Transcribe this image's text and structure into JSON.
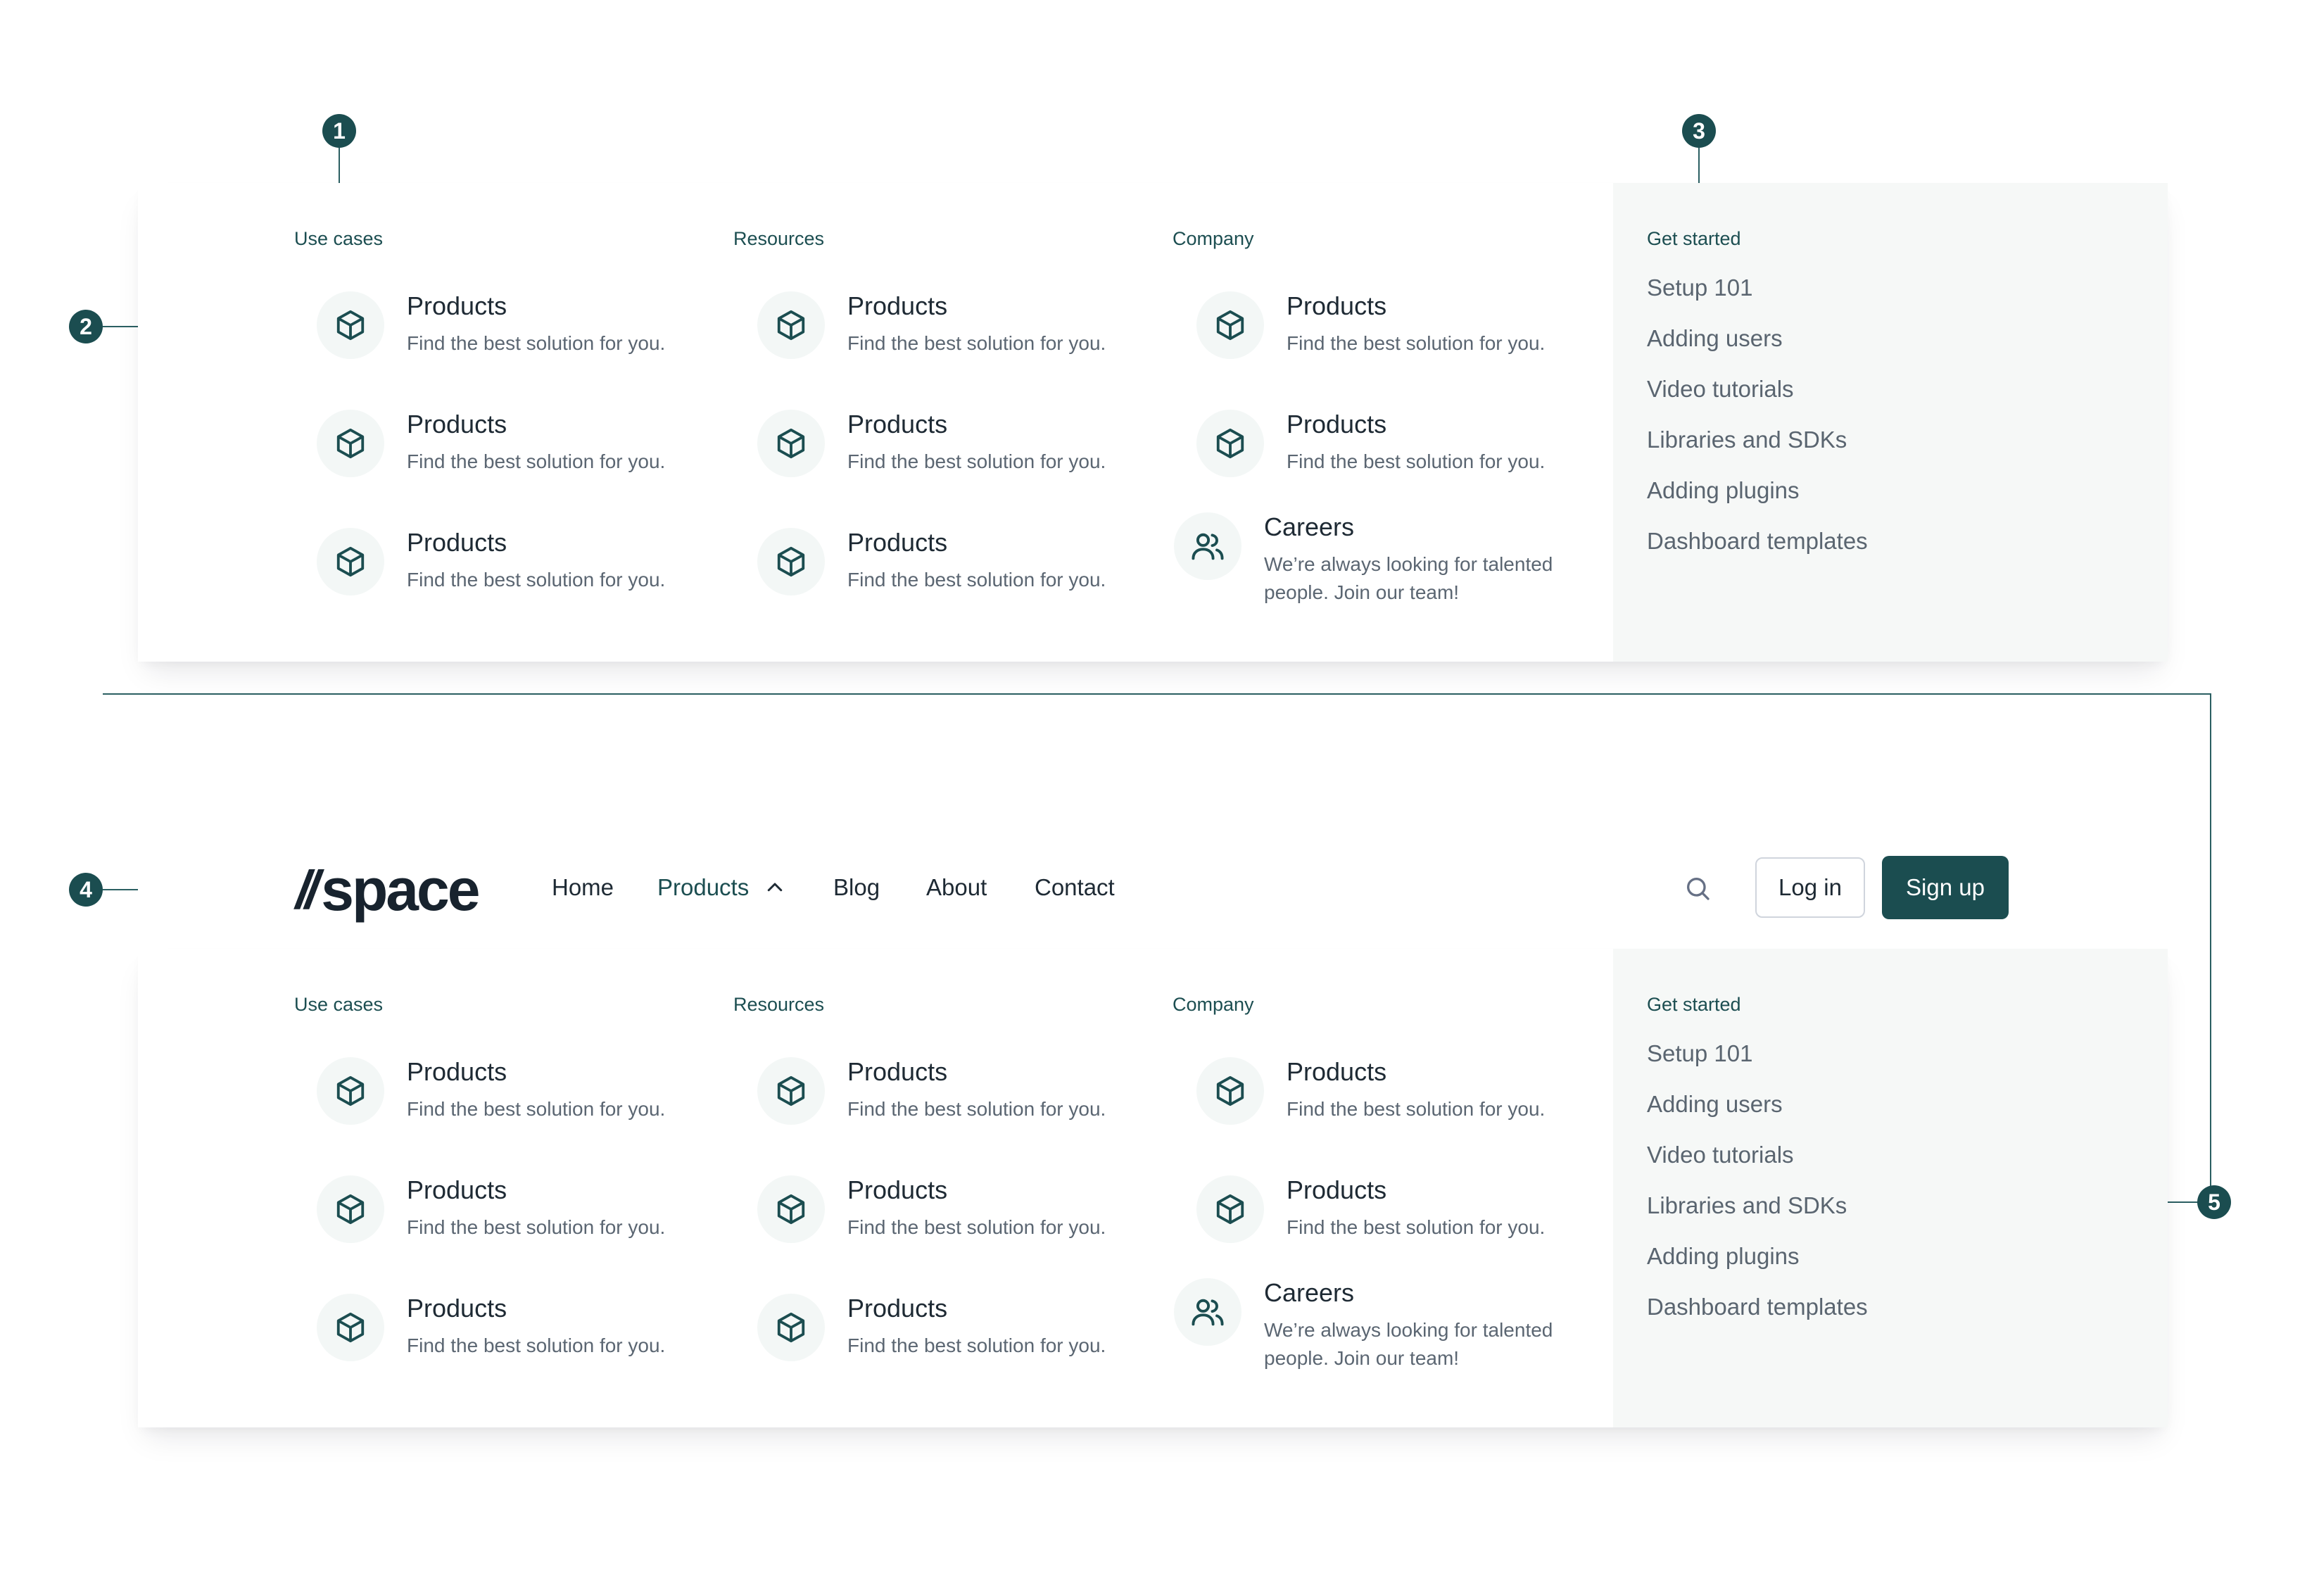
{
  "annotations": {
    "m1": "1",
    "m2": "2",
    "m3": "3",
    "m4": "4",
    "m5": "5"
  },
  "nav": {
    "logo_text": "space",
    "links": [
      "Home",
      "Products",
      "Blog",
      "About",
      "Contact"
    ],
    "active_link": "Products",
    "login_label": "Log in",
    "signup_label": "Sign up",
    "icons": {
      "search": "search-icon",
      "chevron": "chevron-up-icon"
    }
  },
  "menu": {
    "columns": [
      {
        "title": "Use cases",
        "items": [
          {
            "title": "Products",
            "desc": "Find the best solution for you."
          },
          {
            "title": "Products",
            "desc": "Find the best solution for you."
          },
          {
            "title": "Products",
            "desc": "Find the best solution for you."
          }
        ]
      },
      {
        "title": "Resources",
        "items": [
          {
            "title": "Products",
            "desc": "Find the best solution for you."
          },
          {
            "title": "Products",
            "desc": "Find the best solution for you."
          },
          {
            "title": "Products",
            "desc": "Find the best solution for you."
          }
        ]
      },
      {
        "title": "Company",
        "items": [
          {
            "title": "Products",
            "desc": "Find the best solution for you."
          },
          {
            "title": "Products",
            "desc": "Find the best solution for you."
          },
          {
            "title": "Careers",
            "desc": "We’re always looking for talented people. Join our team!"
          }
        ]
      }
    ],
    "sidebar": {
      "title": "Get started",
      "links": [
        "Setup 101",
        "Adding users",
        "Video tutorials",
        "Libraries and SDKs",
        "Adding plugins",
        "Dashboard templates"
      ]
    },
    "icons": {
      "product": "cube-icon",
      "careers": "users-icon"
    }
  },
  "colors": {
    "accent": "#1b4d50",
    "sidebar_bg": "#f6f8f7",
    "icon_bg": "#f3f7f6"
  }
}
